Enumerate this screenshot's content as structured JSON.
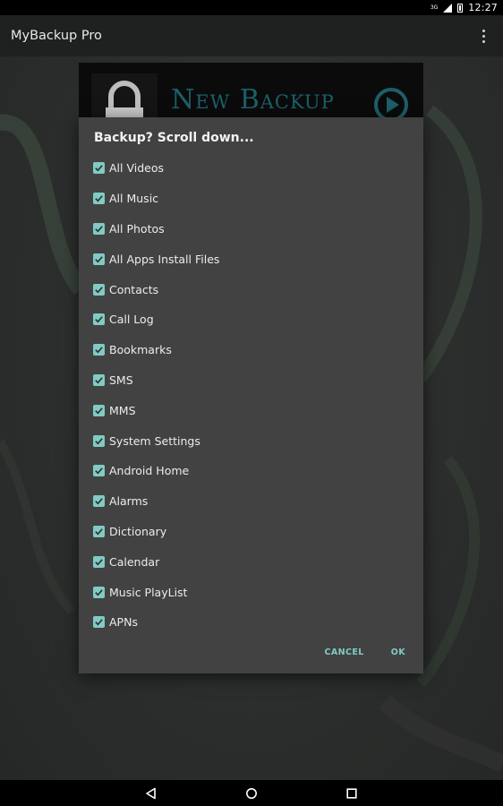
{
  "status_bar": {
    "network": "3G",
    "time": "12:27"
  },
  "app_bar": {
    "title": "MyBackup Pro"
  },
  "banner": {
    "text": "New Backup"
  },
  "dialog": {
    "title": "Backup? Scroll down...",
    "options": [
      {
        "label": "All Videos",
        "checked": true
      },
      {
        "label": "All Music",
        "checked": true
      },
      {
        "label": "All Photos",
        "checked": true
      },
      {
        "label": "All Apps Install Files",
        "checked": true
      },
      {
        "label": "Contacts",
        "checked": true
      },
      {
        "label": "Call Log",
        "checked": true
      },
      {
        "label": "Bookmarks",
        "checked": true
      },
      {
        "label": "SMS",
        "checked": true
      },
      {
        "label": "MMS",
        "checked": true
      },
      {
        "label": "System Settings",
        "checked": true
      },
      {
        "label": "Android Home",
        "checked": true
      },
      {
        "label": "Alarms",
        "checked": true
      },
      {
        "label": "Dictionary",
        "checked": true
      },
      {
        "label": "Calendar",
        "checked": true
      },
      {
        "label": "Music PlayList",
        "checked": true
      },
      {
        "label": "APNs",
        "checked": true
      }
    ],
    "cancel_label": "CANCEL",
    "ok_label": "OK"
  },
  "colors": {
    "accent": "#80cbc4",
    "dialog_bg": "#424242",
    "banner_text": "#1c5f6a"
  }
}
